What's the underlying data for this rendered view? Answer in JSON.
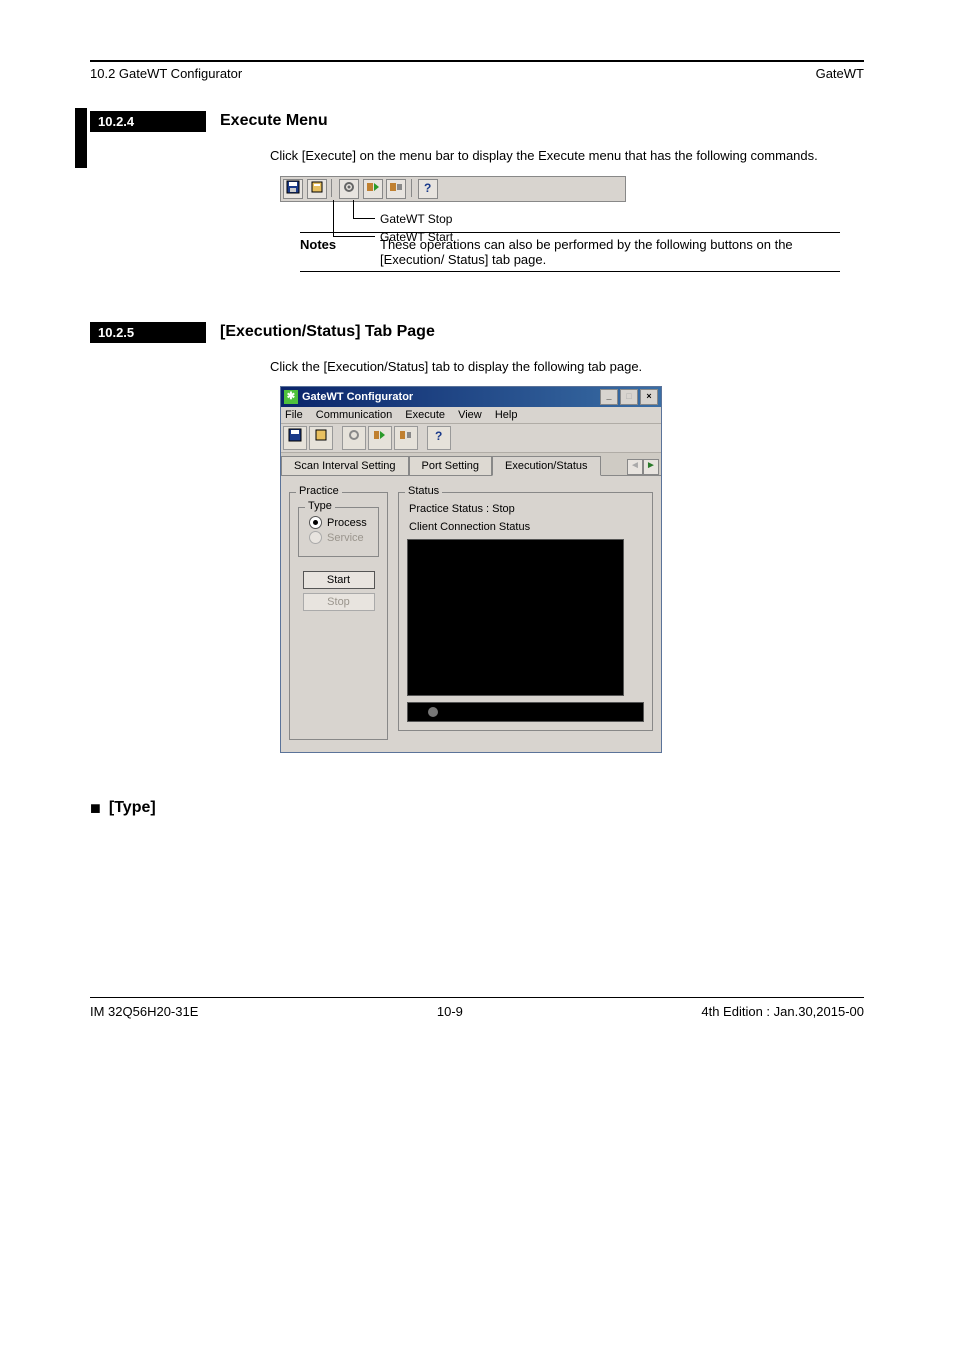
{
  "header": {
    "left": "10.2 GateWT Configurator",
    "right": "GateWT"
  },
  "sec1": {
    "label": "10.2.4",
    "title": "Execute Menu",
    "body": "Click [Execute] on the menu bar to display the Execute menu that has the following commands.",
    "callout1": "GateWT Start",
    "callout2": "GateWT Stop",
    "notes_label": "Notes",
    "note_text": "These operations can also be performed by the following buttons on the [Execution/ Status] tab page."
  },
  "sec2": {
    "label": "10.2.5",
    "title": "[Execution/Status] Tab Page",
    "body": "Click the [Execution/Status] tab to display the following tab page."
  },
  "sec3": {
    "bullet": "■",
    "title": "[Type]"
  },
  "toolbar_fig": {
    "icons": [
      "save-icon",
      "config-icon",
      "gear-icon",
      "start-icon",
      "stop-icon",
      "help-icon"
    ]
  },
  "win": {
    "title": "GateWT Configurator",
    "menus": [
      "File",
      "Communication",
      "Execute",
      "View",
      "Help"
    ],
    "toolbar": [
      "save-icon",
      "config-icon",
      "gear-icon",
      "start-icon",
      "stop-icon",
      "help-icon"
    ],
    "tabs": {
      "t0": "Scan Interval Setting",
      "t1": "Port Setting",
      "t2": "Execution/Status"
    },
    "practice_legend": "Practice",
    "type_legend": "Type",
    "radio_process": "Process",
    "radio_service": "Service",
    "start_btn": "Start",
    "stop_btn": "Stop",
    "status_legend": "Status",
    "practice_status": "Practice Status : Stop",
    "client_status": "Client Connection Status"
  },
  "footer": {
    "left": "IM 32Q56H20-31E",
    "center": "10-9",
    "right": "4th Edition : Jan.30,2015-00"
  }
}
